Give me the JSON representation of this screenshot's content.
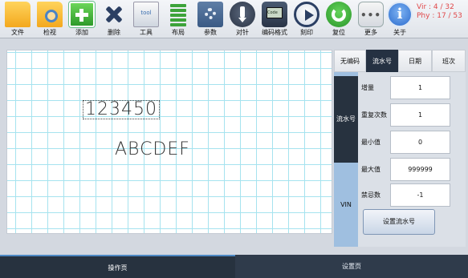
{
  "toolbar": {
    "buttons": [
      {
        "label": "文件",
        "icon": "folder-icon"
      },
      {
        "label": "检视",
        "icon": "magnifier-folder-icon"
      },
      {
        "label": "添加",
        "icon": "plus-icon"
      },
      {
        "label": "删除",
        "icon": "x-icon"
      },
      {
        "label": "工具",
        "icon": "tool-icon",
        "icon_text": "tool"
      },
      {
        "label": "布局",
        "icon": "layout-icon"
      },
      {
        "label": "参数",
        "icon": "gear-icon"
      },
      {
        "label": "对针",
        "icon": "dock-icon"
      },
      {
        "label": "编码格式",
        "icon": "code-icon",
        "icon_text": "Code"
      },
      {
        "label": "刻印",
        "icon": "play-icon"
      },
      {
        "label": "复位",
        "icon": "reset-icon"
      },
      {
        "label": "更多",
        "icon": "more-icon",
        "icon_text": "•••"
      },
      {
        "label": "关于",
        "icon": "info-icon",
        "icon_text": "i"
      }
    ]
  },
  "version": {
    "vir": "Vir : 4 / 32",
    "phy": "Phy : 17 / 53"
  },
  "canvas": {
    "text_objects": [
      "123450",
      "ABCDEF"
    ]
  },
  "tabs": [
    {
      "label": "无编码",
      "active": false
    },
    {
      "label": "流水号",
      "active": true
    },
    {
      "label": "日期",
      "active": false
    },
    {
      "label": "班次",
      "active": false
    }
  ],
  "modes": [
    {
      "label": "流水号",
      "active": true
    },
    {
      "label": "VIN",
      "active": false
    }
  ],
  "serial_settings": {
    "rows": [
      {
        "label": "增量",
        "value": "1"
      },
      {
        "label": "重复次数",
        "value": "1"
      },
      {
        "label": "最小值",
        "value": "0"
      },
      {
        "label": "最大值",
        "value": "999999"
      },
      {
        "label": "禁忌数",
        "value": "-1"
      }
    ],
    "set_button": "设置流水号"
  },
  "bottom_tabs": [
    {
      "label": "操作页",
      "active": true
    },
    {
      "label": "设置页",
      "active": false
    }
  ],
  "colors": {
    "accent_dark": "#27323f",
    "grid": "#a6e3ef",
    "version_text": "#e0484a",
    "mode_column": "#9fbfe0"
  }
}
